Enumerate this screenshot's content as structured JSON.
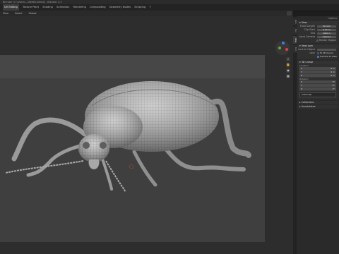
{
  "window": {
    "title": "Blender [C:\\Users\\...\\Beetle.blend] - Blender 4.1"
  },
  "menu": {
    "items": [
      "UV Editing",
      "Texture Paint",
      "Shading",
      "Animation",
      "Rendering",
      "Compositing",
      "Geometry Nodes",
      "Scripting",
      "+"
    ],
    "active_index": 0
  },
  "viewport_header": {
    "view_label": "View",
    "select_label": "Select",
    "transform_label": "Global",
    "colors": {
      "header_bg": "#2a2a2a"
    }
  },
  "gizmo": {
    "axes": [
      {
        "name": "X",
        "color": "#e0404a"
      },
      {
        "name": "Y",
        "color": "#6fa83a"
      },
      {
        "name": "Z",
        "color": "#3f7fd9"
      }
    ]
  },
  "sidebar_tabs": [
    "Item",
    "Tool",
    "View",
    "Edit"
  ],
  "npanel": {
    "options_label": "Options",
    "view_section": {
      "title": "View",
      "focal_label": "Focal Length",
      "focal_value": "50 mm",
      "clip_start_label": "Clip Start",
      "clip_start_value": "0.01 m",
      "clip_end_label": "End",
      "clip_end_value": "1000 m",
      "local_camera_label": "Local Camera",
      "local_camera_value": "Camera",
      "render_region_label": "Render Region"
    },
    "view_lock_section": {
      "title": "View Lock",
      "lock_to_object_label": "Lock to Object",
      "lock_label": "Lock",
      "to_3d_cursor_label": "To 3D Cursor",
      "camera_to_view_label": "Camera to View"
    },
    "cursor_section": {
      "title": "3D Cursor",
      "location_label": "Location",
      "location": [
        {
          "axis": "X",
          "value": "0 m"
        },
        {
          "axis": "Y",
          "value": "0 m"
        },
        {
          "axis": "Z",
          "value": "0 m"
        }
      ],
      "rotation_label": "Rotation",
      "rotation": [
        {
          "axis": "X",
          "value": "0°"
        },
        {
          "axis": "Y",
          "value": "0°"
        },
        {
          "axis": "Z",
          "value": "0°"
        }
      ],
      "rotation_mode": "XYZ Euler"
    },
    "collapsed_sections": [
      "Collections",
      "Annotations"
    ]
  }
}
